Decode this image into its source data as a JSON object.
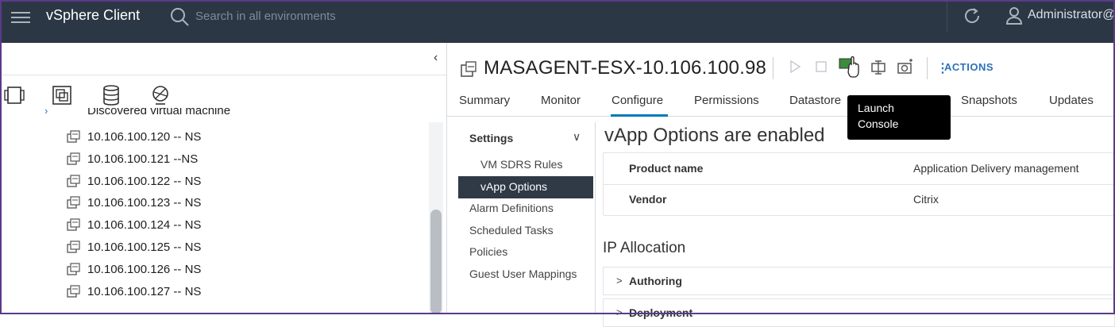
{
  "topbar": {
    "app_title": "vSphere Client",
    "search_placeholder": "Search in all environments",
    "user": "Administrator@"
  },
  "inventory": {
    "partial_item": "Discovered virtual machine",
    "items": [
      "10.106.100.120 -- NS",
      "10.106.100.121 --NS",
      "10.106.100.122 -- NS",
      "10.106.100.123 -- NS",
      "10.106.100.124 -- NS",
      "10.106.100.125 -- NS",
      "10.106.100.126 -- NS",
      "10.106.100.127 -- NS"
    ]
  },
  "vm": {
    "title": "MASAGENT-ESX-10.106.100.98",
    "actions_label": "ACTIONS",
    "tooltip_line1": "Launch",
    "tooltip_line2": "Console"
  },
  "tabs": [
    "Summary",
    "Monitor",
    "Configure",
    "Permissions",
    "Datastore",
    "Snapshots",
    "Updates"
  ],
  "active_tab": "Configure",
  "settings_nav": {
    "header": "Settings",
    "items": [
      "VM SDRS Rules",
      "vApp Options",
      "Alarm Definitions",
      "Scheduled Tasks",
      "Policies",
      "Guest User Mappings"
    ],
    "active": "vApp Options"
  },
  "content": {
    "heading": "vApp Options are enabled",
    "properties": [
      {
        "key": "Product name",
        "value": "Application Delivery management"
      },
      {
        "key": "Vendor",
        "value": "Citrix"
      }
    ],
    "ip_heading": "IP Allocation",
    "sections": [
      "Authoring",
      "Deployment"
    ]
  },
  "colors": {
    "topbar_bg": "#2b3744",
    "accent": "#0079b8",
    "active_nav_bg": "#2f3a46"
  }
}
